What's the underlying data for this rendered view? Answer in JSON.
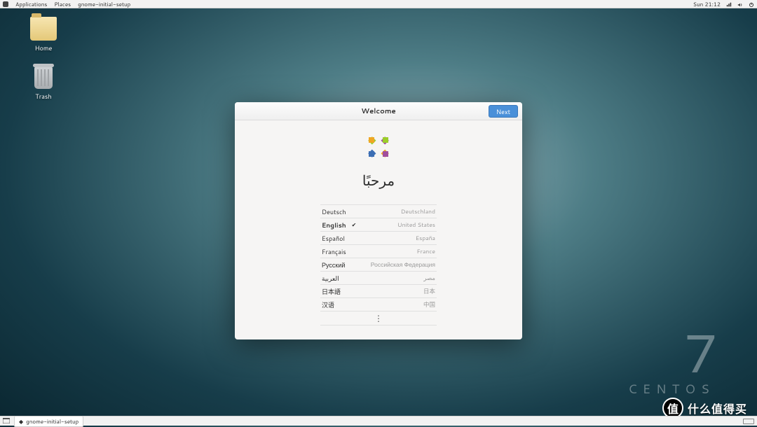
{
  "topbar": {
    "menus": [
      "Applications",
      "Places",
      "gnome-initial-setup"
    ],
    "clock": "Sun 21:12"
  },
  "desktop": {
    "icons": [
      {
        "name": "home-folder",
        "label": "Home"
      },
      {
        "name": "trash",
        "label": "Trash"
      }
    ]
  },
  "brand": {
    "version": "7",
    "name": "CENTOS"
  },
  "setup": {
    "title": "Welcome",
    "next_label": "Next",
    "greeting": "مرحبًا",
    "languages": [
      {
        "lang": "Deutsch",
        "country": "Deutschland",
        "selected": false
      },
      {
        "lang": "English",
        "country": "United States",
        "selected": true
      },
      {
        "lang": "Español",
        "country": "España",
        "selected": false
      },
      {
        "lang": "Français",
        "country": "France",
        "selected": false
      },
      {
        "lang": "Русский",
        "country": "Российская Федерация",
        "selected": false
      },
      {
        "lang": "العربية",
        "country": "مصر",
        "selected": false
      },
      {
        "lang": "日本語",
        "country": "日本",
        "selected": false
      },
      {
        "lang": "汉语",
        "country": "中国",
        "selected": false
      }
    ],
    "more_glyph": "⋮"
  },
  "taskbar": {
    "task_label": "gnome-initial-setup"
  },
  "watermark": {
    "badge": "值",
    "text": "什么值得买"
  }
}
